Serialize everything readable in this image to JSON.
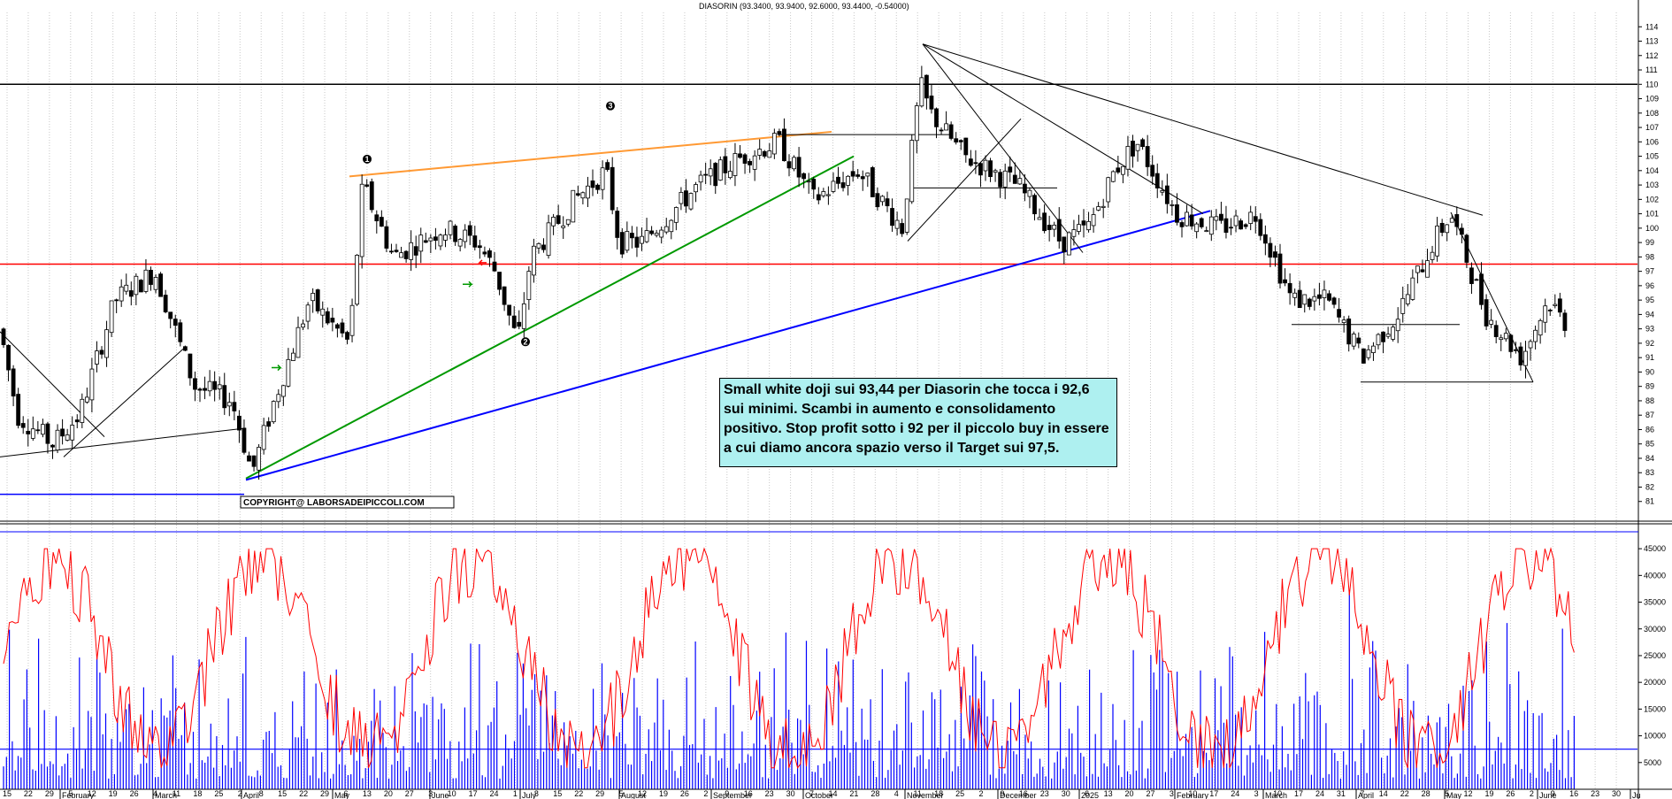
{
  "chart_title": "DIASORIN (93.3400, 93.9400, 92.6000, 93.4400, -0.54000)",
  "copyright": "COPYRIGHT@ LABORSADEIPICCOLI.COM",
  "note": "Small white doji sui 93,44 per Diasorin che tocca i 92,6 sui minimi. Scambi in aumento e consolidamento positivo. Stop profit sotto i 92 per il piccolo buy in essere a cui diamo ancora spazio verso il Target sui 97,5.",
  "colors": {
    "background": "#ffffff",
    "candles": "#000000",
    "resistance_line": "#ff0000",
    "orange_trend": "#ff9933",
    "green_trend": "#009900",
    "blue_trend": "#0000ff",
    "volume_bars": "#0000ff",
    "oscillator": "#ff0000",
    "grid": "#c8c8c8"
  },
  "chart_data": [
    {
      "type": "candlestick",
      "title": "DIASORIN (93.3400, 93.9400, 92.6000, 93.4400, -0.54000)",
      "ylim": [
        80,
        115
      ],
      "y_ticks": [
        81,
        82,
        83,
        84,
        85,
        86,
        87,
        88,
        89,
        90,
        91,
        92,
        93,
        94,
        95,
        96,
        97,
        98,
        99,
        100,
        101,
        102,
        103,
        104,
        105,
        106,
        107,
        108,
        109,
        110,
        111,
        112,
        113,
        114
      ],
      "grid": true,
      "last_bar": {
        "open": 93.34,
        "high": 93.94,
        "low": 92.6,
        "close": 93.44,
        "change": -0.54
      },
      "horizontal_lines": [
        {
          "value": 97.5,
          "color": "#ff0000"
        },
        {
          "value": 110,
          "color": "#000000"
        },
        {
          "value": 81.5,
          "color": "#0000ff",
          "segment": "left"
        }
      ],
      "trendlines": [
        {
          "name": "orange",
          "from": [
            395,
            103.6
          ],
          "to": [
            940,
            106.7
          ],
          "color": "#ff9933"
        },
        {
          "name": "green",
          "from": [
            278,
            82.6
          ],
          "to": [
            965,
            105
          ],
          "color": "#009900"
        },
        {
          "name": "blue",
          "from": [
            278,
            82.5
          ],
          "to": [
            1368,
            101.2
          ],
          "color": "#0000ff"
        },
        {
          "name": "black-top",
          "from": [
            1043,
            112.8
          ],
          "to": [
            1676,
            100.9
          ],
          "color": "#000000"
        },
        {
          "name": "black-left",
          "from": [
            0,
            84.1
          ],
          "to": [
            278,
            86.1
          ],
          "color": "#000000"
        },
        {
          "name": "black-down-1",
          "from": [
            0,
            92.8
          ],
          "to": [
            118,
            85.5
          ],
          "color": "#000000"
        },
        {
          "name": "black-up-1",
          "from": [
            72,
            84.1
          ],
          "to": [
            207,
            91.6
          ],
          "color": "#000000"
        },
        {
          "name": "black-fan-1",
          "from": [
            1043,
            112.8
          ],
          "to": [
            1224,
            98.3
          ],
          "color": "#000000"
        },
        {
          "name": "black-fan-2",
          "from": [
            1043,
            112.8
          ],
          "to": [
            1360,
            101
          ],
          "color": "#000000"
        },
        {
          "name": "black-fan-3",
          "from": [
            1026,
            99.1
          ],
          "to": [
            1154,
            107.6
          ],
          "color": "#000000"
        },
        {
          "name": "black-down-2",
          "from": [
            1640,
            101.1
          ],
          "to": [
            1733,
            89.3
          ],
          "color": "#000000"
        },
        {
          "name": "black-shelf-1",
          "from": [
            880,
            106.5
          ],
          "to": [
            1075,
            106.5
          ],
          "color": "#000000"
        },
        {
          "name": "black-shelf-2",
          "from": [
            1030,
            102.8
          ],
          "to": [
            1195,
            102.8
          ],
          "color": "#000000"
        },
        {
          "name": "black-shelf-3",
          "from": [
            1460,
            93.3
          ],
          "to": [
            1650,
            93.3
          ],
          "color": "#000000"
        },
        {
          "name": "black-shelf-4",
          "from": [
            1538,
            89.3
          ],
          "to": [
            1733,
            89.3
          ],
          "color": "#000000"
        }
      ],
      "markers": [
        {
          "label": "1",
          "value": 104.8
        },
        {
          "label": "2",
          "value": 92.1
        },
        {
          "label": "3",
          "value": 108.5
        }
      ]
    },
    {
      "type": "bar",
      "title": "Volume",
      "ylim": [
        0,
        48000
      ],
      "y_ticks": [
        5000,
        10000,
        15000,
        20000,
        25000,
        30000,
        35000,
        40000,
        45000
      ],
      "reference_lines": [
        7500
      ],
      "oscillator_color": "#ff0000",
      "volume_color": "#0000ff"
    }
  ],
  "x_axis": {
    "day_labels": [
      "15",
      "22",
      "29",
      "5",
      "12",
      "19",
      "26",
      "4",
      "11",
      "18",
      "25",
      "2",
      "8",
      "15",
      "22",
      "29",
      "6",
      "13",
      "20",
      "27",
      "3",
      "10",
      "17",
      "24",
      "1",
      "8",
      "15",
      "22",
      "29",
      "5",
      "12",
      "19",
      "26",
      "2",
      "9",
      "16",
      "23",
      "30",
      "7",
      "14",
      "21",
      "28",
      "4",
      "11",
      "18",
      "25",
      "2",
      "9",
      "16",
      "23",
      "30",
      "6",
      "13",
      "20",
      "27",
      "3",
      "10",
      "17",
      "24",
      "3",
      "10",
      "17",
      "24",
      "31",
      "7",
      "14",
      "22",
      "28",
      "5",
      "12",
      "19",
      "26",
      "2",
      "9",
      "16",
      "23",
      "30"
    ],
    "month_labels": [
      "February",
      "March",
      "April",
      "May",
      "June",
      "July",
      "August",
      "September",
      "October",
      "November",
      "December",
      "2025",
      "February",
      "March",
      "April",
      "May",
      "June",
      "Ju"
    ]
  }
}
